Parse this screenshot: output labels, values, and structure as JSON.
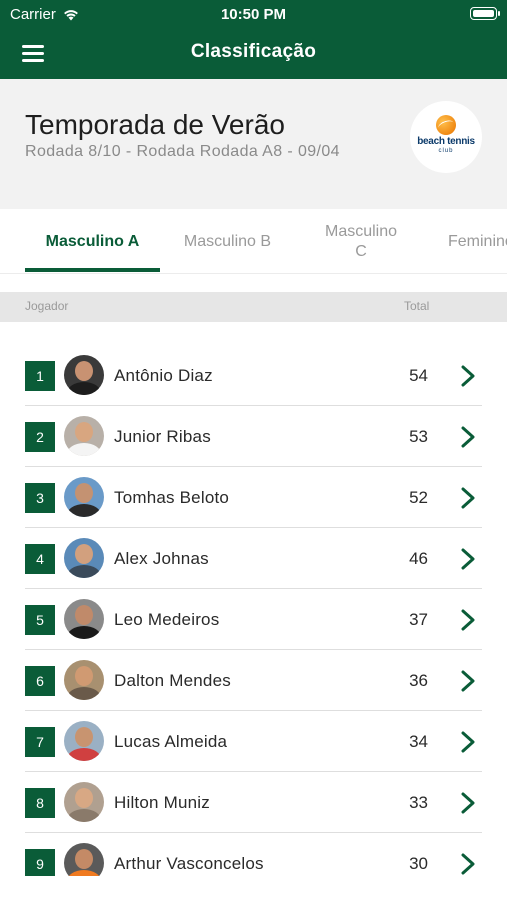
{
  "status_bar": {
    "carrier": "Carrier",
    "time": "10:50 PM"
  },
  "nav": {
    "title": "Classificação",
    "menu_icon": "hamburger-menu-icon"
  },
  "header": {
    "title": "Temporada de Verão",
    "subtitle": "Rodada 8/10 - Rodada Rodada A8 - 09/04",
    "logo": {
      "line1": "beach tennis",
      "line2": "club"
    }
  },
  "tabs": [
    {
      "label": "Masculino A",
      "active": true
    },
    {
      "label": "Masculino B",
      "active": false
    },
    {
      "label": "Masculino C",
      "active": false
    },
    {
      "label": "Feminino",
      "active": false
    }
  ],
  "table": {
    "col_player": "Jogador",
    "col_total": "Total",
    "rows": [
      {
        "rank": "1",
        "name": "Antônio Diaz",
        "total": "54"
      },
      {
        "rank": "2",
        "name": "Junior Ribas",
        "total": "53"
      },
      {
        "rank": "3",
        "name": "Tomhas Beloto",
        "total": "52"
      },
      {
        "rank": "4",
        "name": "Alex Johnas",
        "total": "46"
      },
      {
        "rank": "5",
        "name": "Leo Medeiros",
        "total": "37"
      },
      {
        "rank": "6",
        "name": "Dalton Mendes",
        "total": "36"
      },
      {
        "rank": "7",
        "name": "Lucas Almeida",
        "total": "34"
      },
      {
        "rank": "8",
        "name": "Hilton Muniz",
        "total": "33"
      },
      {
        "rank": "9",
        "name": "Arthur Vasconcelos",
        "total": "30"
      }
    ]
  },
  "colors": {
    "brand_green": "#0a5c38",
    "header_bg": "#f2f2f2",
    "column_header_bg": "#e6e6e6"
  }
}
